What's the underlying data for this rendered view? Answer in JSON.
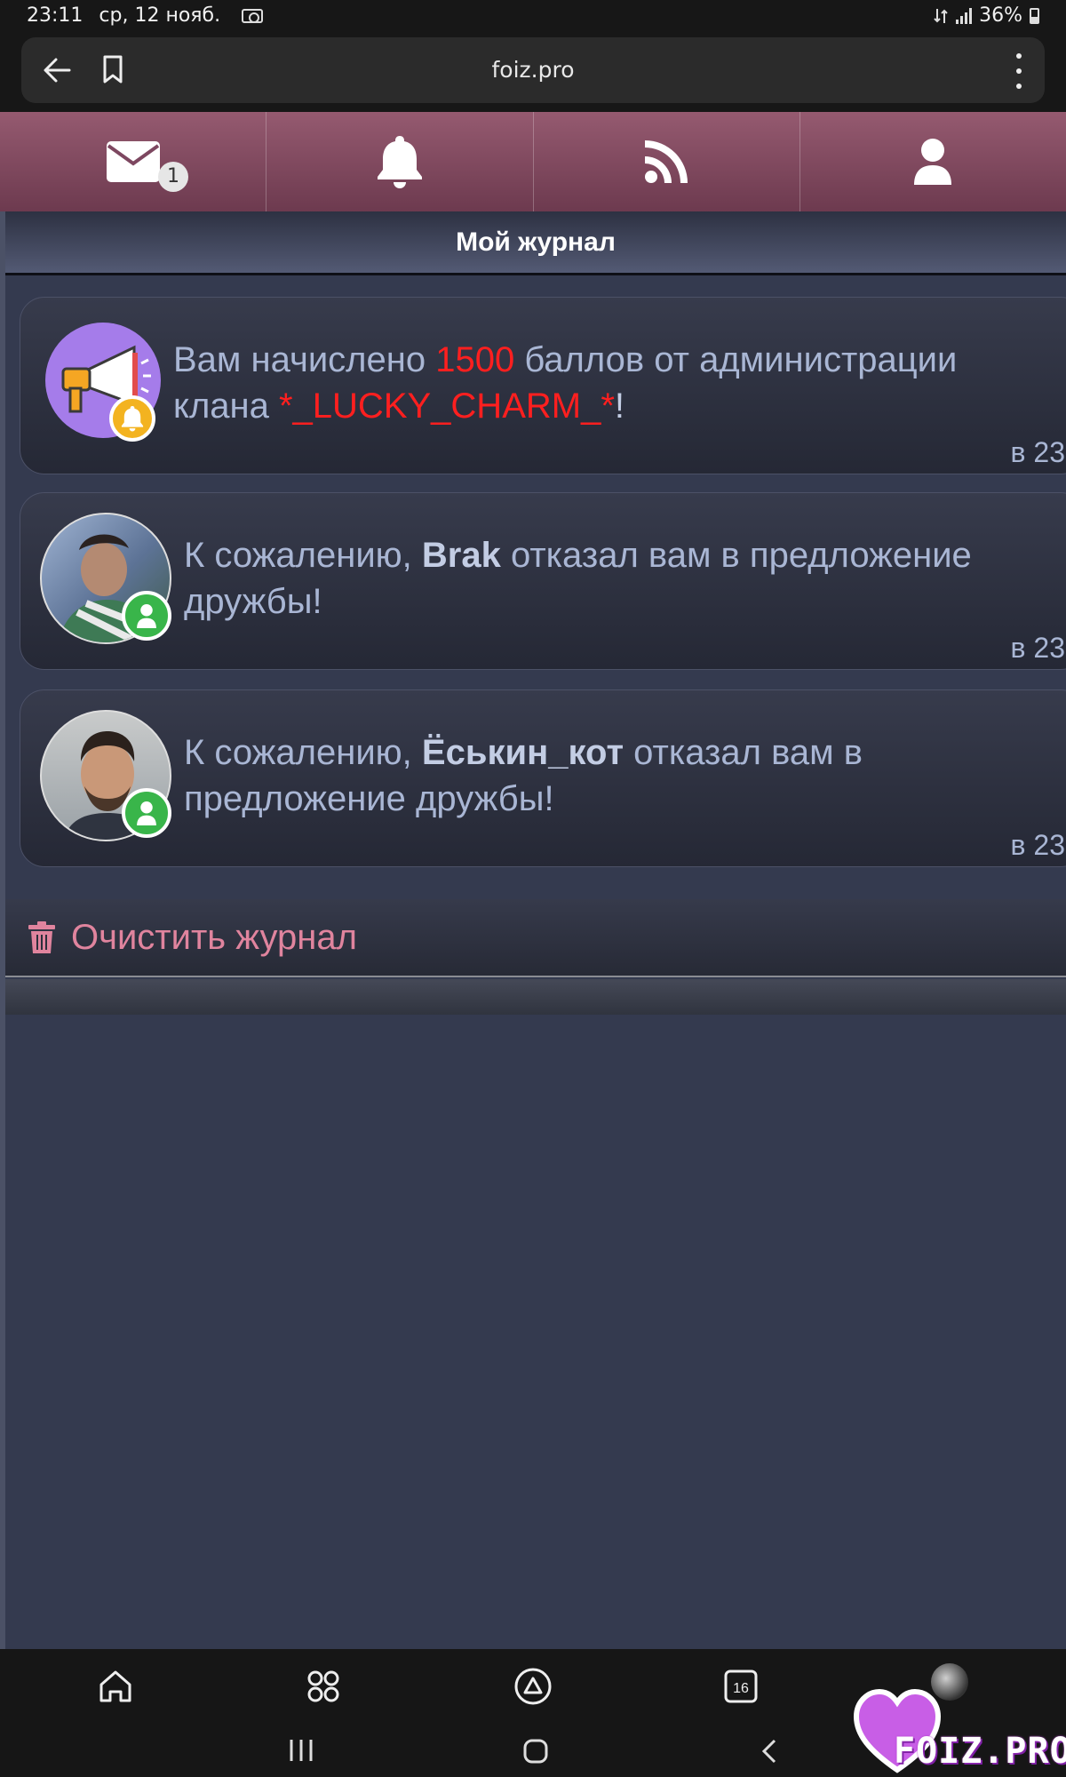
{
  "status_bar": {
    "time": "23:11",
    "date": "ср, 12 нояб.",
    "battery": "36%",
    "icons": [
      "camera-icon",
      "data-icon",
      "signal-icon",
      "battery-icon"
    ]
  },
  "browser": {
    "url": "foiz.pro",
    "icons": [
      "back-arrow-icon",
      "bookmark-icon",
      "more-vert-icon"
    ]
  },
  "nav_tabs": [
    {
      "icon": "envelope-icon",
      "badge": "1"
    },
    {
      "icon": "bell-icon"
    },
    {
      "icon": "rss-icon"
    },
    {
      "icon": "user-icon"
    }
  ],
  "header": {
    "title": "Мой журнал"
  },
  "notifications": [
    {
      "avatar": "megaphone-icon",
      "badge_icon": "bell-icon",
      "text_before": "Вам начислено ",
      "highlight": "1500",
      "text_middle": " баллов от администрации клана ",
      "clan": "*_LUCKY_CHARM_*",
      "text_after": "!",
      "time": "в 23"
    },
    {
      "avatar": "user-photo",
      "badge_icon": "user-icon",
      "text_before": "К сожалению, ",
      "name": "Brak",
      "text_after": " отказал вам в предложение дружбы!",
      "time": "в 23"
    },
    {
      "avatar": "user-photo",
      "badge_icon": "user-icon",
      "text_before": "К сожалению, ",
      "name": "Ёськин_кот",
      "text_after": " отказал вам в предложение дружбы!",
      "time": "в 23"
    }
  ],
  "clear": {
    "label": "Очистить журнал",
    "icon": "trash-icon"
  },
  "bottom_nav": {
    "icons": [
      "home-icon",
      "apps-icon",
      "assistant-icon",
      "calendar-icon",
      "profile-avatar"
    ],
    "calendar_day": "16",
    "system_icons": [
      "recents-icon",
      "home-button-icon",
      "back-icon"
    ]
  },
  "watermark": {
    "text": "FOIZ.PRO"
  },
  "colors": {
    "accent": "#e0849e",
    "tab_bar": "#7d4760",
    "background": "#343a4f",
    "highlight_red": "#ff1f1f",
    "online_badge": "#39b54a",
    "bell_badge": "#f3b320"
  }
}
